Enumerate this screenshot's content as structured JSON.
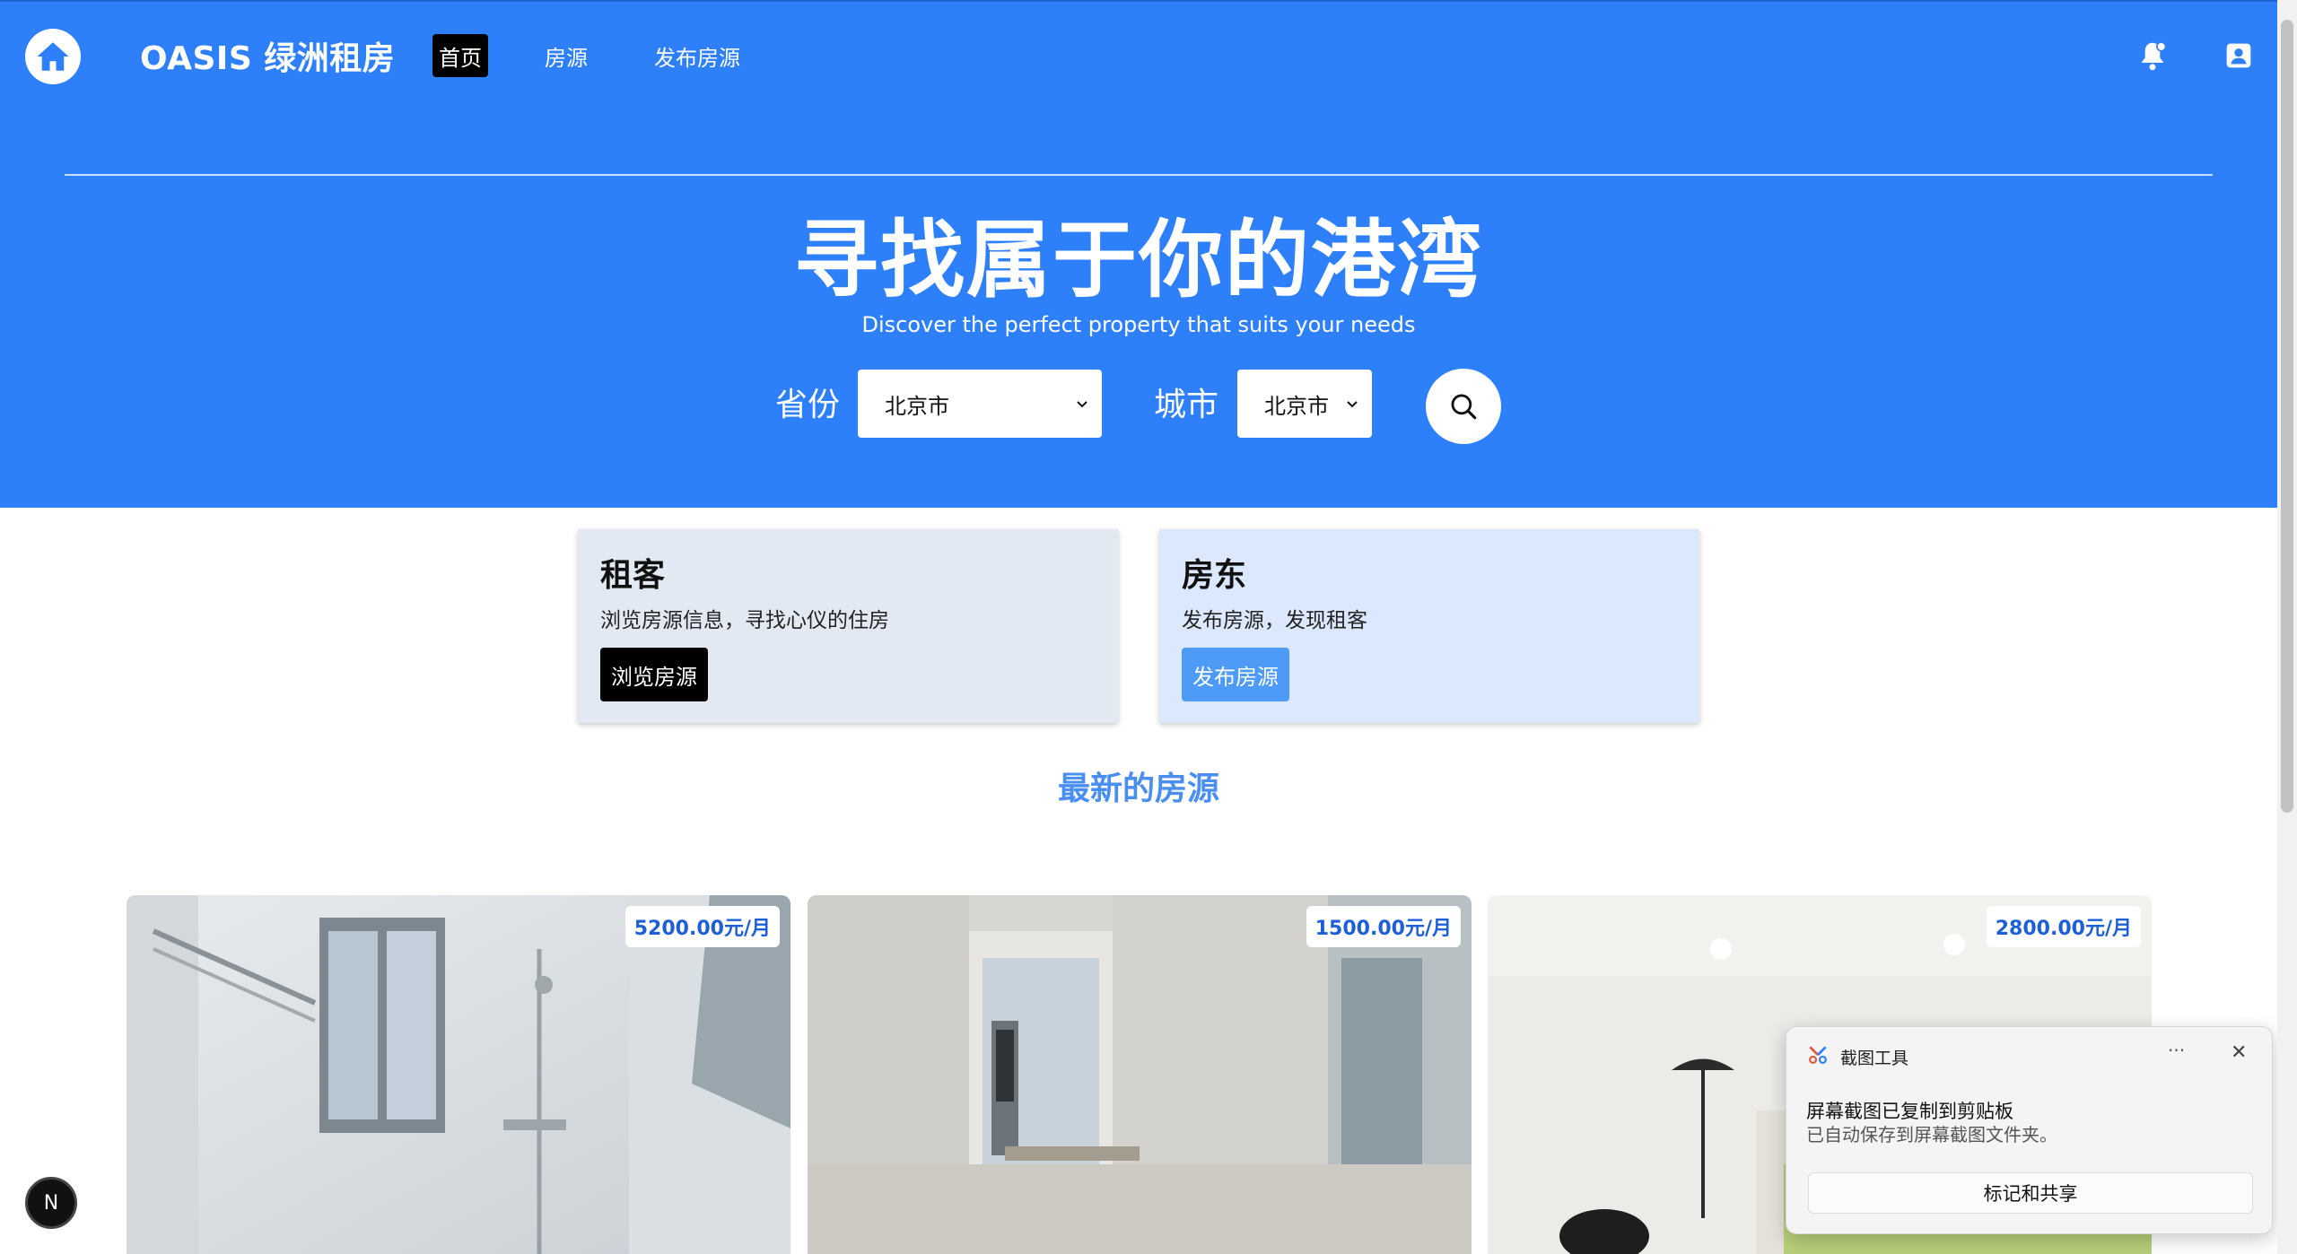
{
  "header": {
    "brand": "OASIS 绿洲租房",
    "nav": [
      "首页",
      "房源",
      "发布房源"
    ]
  },
  "hero": {
    "title": "寻找属于你的港湾",
    "subtitle": "Discover the perfect property that suits your needs",
    "province_label": "省份",
    "province_value": "北京市",
    "city_label": "城市",
    "city_value": "北京市"
  },
  "roles": {
    "tenant": {
      "title": "租客",
      "desc": "浏览房源信息，寻找心仪的住房",
      "button": "浏览房源"
    },
    "landlord": {
      "title": "房东",
      "desc": "发布房源，发现租客",
      "button": "发布房源"
    }
  },
  "latest": {
    "title": "最新的房源",
    "listings": [
      {
        "price": "5200.00元/月"
      },
      {
        "price": "1500.00元/月"
      },
      {
        "price": "2800.00元/月"
      }
    ]
  },
  "dev_badge": "N",
  "toast": {
    "app_name": "截图工具",
    "more": "···",
    "close": "✕",
    "heading": "屏幕截图已复制到剪贴板",
    "body": "已自动保存到屏幕截图文件夹。",
    "action": "标记和共享"
  },
  "colors": {
    "primary": "#2e7ffa",
    "accent_title": "#4a8ef0",
    "price_text": "#1f5fd6"
  },
  "icons": {
    "logo": "home-icon",
    "bell": "bell-icon",
    "profile": "profile-icon",
    "search": "search-icon",
    "dropdown": "chevron-down-icon"
  }
}
